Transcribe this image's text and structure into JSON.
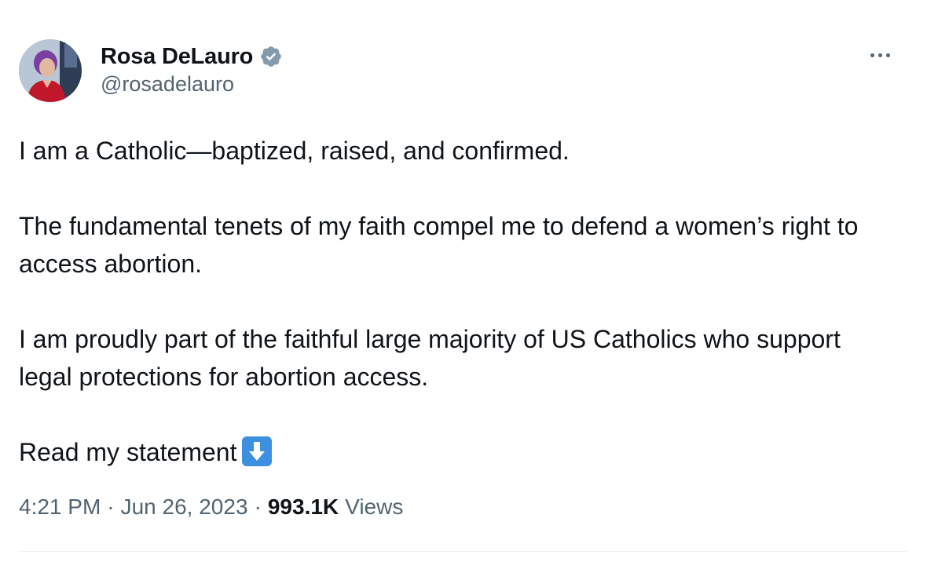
{
  "author": {
    "display_name": "Rosa DeLauro",
    "handle": "@rosadelauro",
    "verified": true,
    "verified_color": "#829aab"
  },
  "tweet": {
    "paragraphs": [
      "I am a Catholic—baptized, raised, and confirmed.",
      "The fundamental tenets of my faith compel me to defend a women’s right to access abortion.",
      "I am proudly part of the faithful large majority of US Catholics who support legal protections for abortion access."
    ],
    "final_line": "Read my statement",
    "final_emoji": "down-arrow-icon"
  },
  "meta": {
    "time": "4:21 PM",
    "separator": "·",
    "date": "Jun 26, 2023",
    "views_count": "993.1K",
    "views_label": "Views"
  },
  "colors": {
    "text_primary": "#0f1419",
    "text_secondary": "#536471",
    "emoji_blue": "#3d8fe0"
  }
}
